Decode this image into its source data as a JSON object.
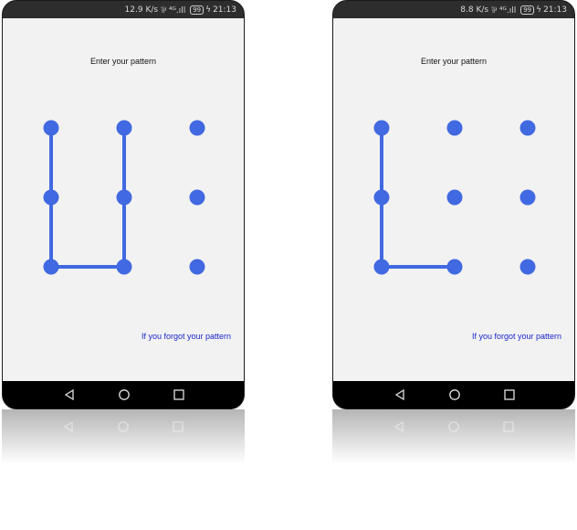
{
  "colors": {
    "accent": "#4169e1",
    "link": "#1a27c9",
    "screen_bg": "#f2f2f2",
    "status_bg": "#2d2d2d",
    "nav_bg": "#000000"
  },
  "phones": [
    {
      "status": {
        "speed": "12.9 K/s",
        "signal": "⅌ ⁴ᴳ.ıll",
        "battery": "99",
        "time": "21:13"
      },
      "title": "Enter your pattern",
      "forgot_link": "If you forgot your pattern",
      "pattern_path": [
        1,
        4,
        7,
        8,
        2
      ]
    },
    {
      "status": {
        "speed": "8.8 K/s",
        "signal": "⅌ ⁴ᴳ.ıll",
        "battery": "99",
        "time": "21:13"
      },
      "title": "Enter your pattern",
      "forgot_link": "If you forgot your pattern",
      "pattern_path": [
        1,
        4,
        7,
        8
      ]
    }
  ],
  "nav": {
    "back": "back-icon",
    "home": "home-icon",
    "recent": "recent-apps-icon"
  }
}
